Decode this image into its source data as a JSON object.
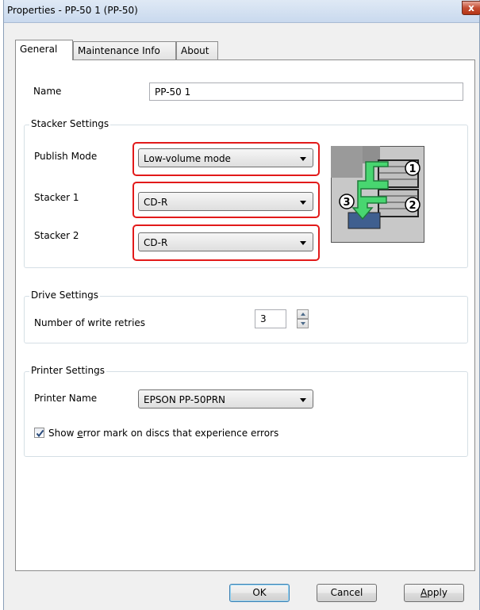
{
  "window": {
    "title": "Properties - PP-50 1 (PP-50)",
    "close_label": "x"
  },
  "tabs": [
    {
      "label": "General",
      "active": true
    },
    {
      "label": "Maintenance Info",
      "active": false
    },
    {
      "label": "About",
      "active": false
    }
  ],
  "name_field": {
    "label": "Name",
    "value": "PP-50 1"
  },
  "stacker_settings": {
    "title": "Stacker Settings",
    "publish_mode": {
      "label": "Publish Mode",
      "value": "Low-volume mode"
    },
    "stacker1": {
      "label": "Stacker 1",
      "value": "CD-R"
    },
    "stacker2": {
      "label": "Stacker 2",
      "value": "CD-R"
    },
    "diagram_numbers": [
      "1",
      "2",
      "3"
    ]
  },
  "drive_settings": {
    "title": "Drive Settings",
    "retries_label": "Number of write retries",
    "retries_value": "3"
  },
  "printer_settings": {
    "title": "Printer Settings",
    "printer_name_label": "Printer Name",
    "printer_name_value": "EPSON PP-50PRN",
    "error_mark": {
      "label_pre": "Show ",
      "label_accel": "e",
      "label_post": "rror mark on discs that experience errors",
      "checked": true
    }
  },
  "buttons": {
    "ok": "OK",
    "cancel": "Cancel",
    "apply_accel": "A",
    "apply_rest": "pply"
  },
  "colors": {
    "highlight": "#e21a1a",
    "accent": "#3c7fb1",
    "arrow_green": "#3fc26a"
  }
}
